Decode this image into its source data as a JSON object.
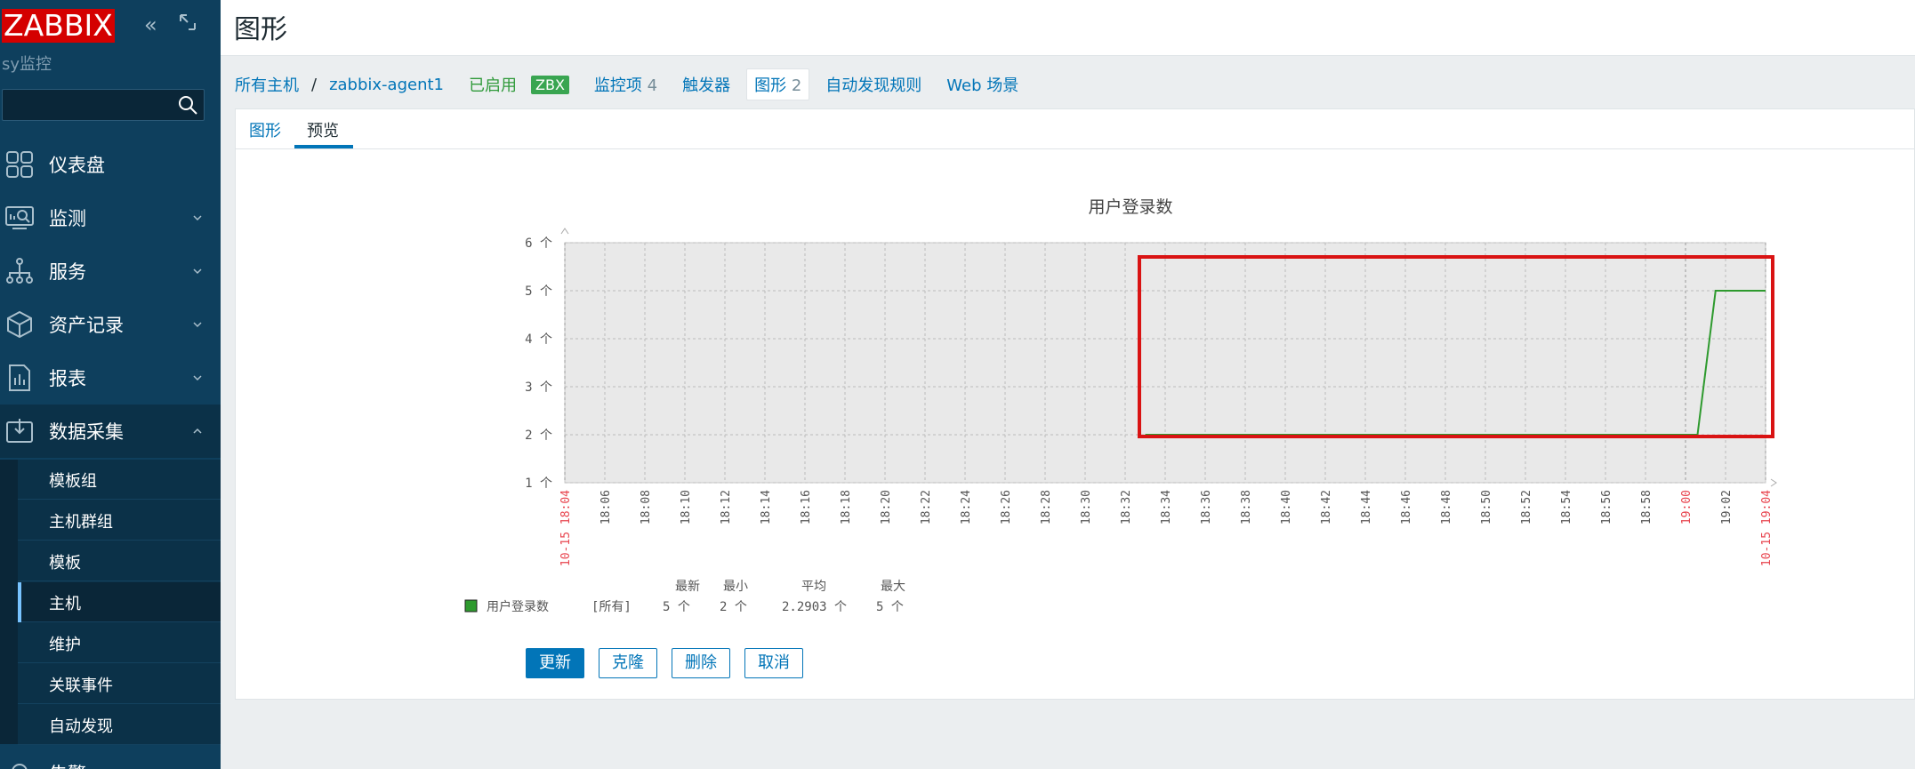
{
  "sidebar": {
    "logo": "ZABBIX",
    "server_name": "sy监控",
    "search_placeholder": "",
    "menu": [
      {
        "label": "仪表盘",
        "icon": "dashboard-icon"
      },
      {
        "label": "监测",
        "icon": "monitoring-icon"
      },
      {
        "label": "服务",
        "icon": "services-icon"
      },
      {
        "label": "资产记录",
        "icon": "inventory-icon"
      },
      {
        "label": "报表",
        "icon": "reports-icon"
      },
      {
        "label": "数据采集",
        "icon": "data-collection-icon"
      },
      {
        "label": "告警",
        "icon": "alerts-icon"
      }
    ],
    "submenu": [
      "模板组",
      "主机群组",
      "模板",
      "主机",
      "维护",
      "关联事件",
      "自动发现"
    ]
  },
  "header": {
    "title": "图形"
  },
  "hostnav": {
    "all_hosts": "所有主机",
    "separator": "/",
    "host": "zabbix-agent1",
    "status": "已启用",
    "zbx": "ZBX",
    "items_label": "监控项",
    "items_count": "4",
    "triggers": "触发器",
    "graphs_label": "图形",
    "graphs_count": "2",
    "discovery": "自动发现规则",
    "web": "Web 场景"
  },
  "tabs": {
    "graph": "图形",
    "preview": "预览"
  },
  "chart_data": {
    "type": "line",
    "title": "用户登录数",
    "unit": "个",
    "y_ticks": [
      "6 个",
      "5 个",
      "4 个",
      "3 个",
      "2 个",
      "1 个"
    ],
    "ylim": [
      1,
      6
    ],
    "x_ticks": [
      "10-15 18:04",
      "18:06",
      "18:08",
      "18:10",
      "18:12",
      "18:14",
      "18:16",
      "18:18",
      "18:20",
      "18:22",
      "18:24",
      "18:26",
      "18:28",
      "18:30",
      "18:32",
      "18:34",
      "18:36",
      "18:38",
      "18:40",
      "18:42",
      "18:44",
      "18:46",
      "18:48",
      "18:50",
      "18:52",
      "18:54",
      "18:56",
      "18:58",
      "19:00",
      "19:02",
      "10-15 19:04"
    ],
    "series": [
      {
        "name": "用户登录数",
        "color": "#2e9a2e",
        "points": [
          [
            "18:33",
            2
          ],
          [
            "18:34",
            2
          ],
          [
            "19:00",
            2
          ],
          [
            "19:00.6",
            2
          ],
          [
            "19:01.5",
            5
          ],
          [
            "19:04",
            5
          ]
        ]
      }
    ],
    "legend": {
      "headers": [
        "最新",
        "最小",
        "平均",
        "最大"
      ],
      "row": {
        "name": "用户登录数",
        "func": "[所有]",
        "last": "5 个",
        "min": "2 个",
        "avg": "2.2903 个",
        "max": "5 个"
      }
    },
    "highlight": "red-rectangle"
  },
  "buttons": {
    "update": "更新",
    "clone": "克隆",
    "delete": "删除",
    "cancel": "取消"
  }
}
